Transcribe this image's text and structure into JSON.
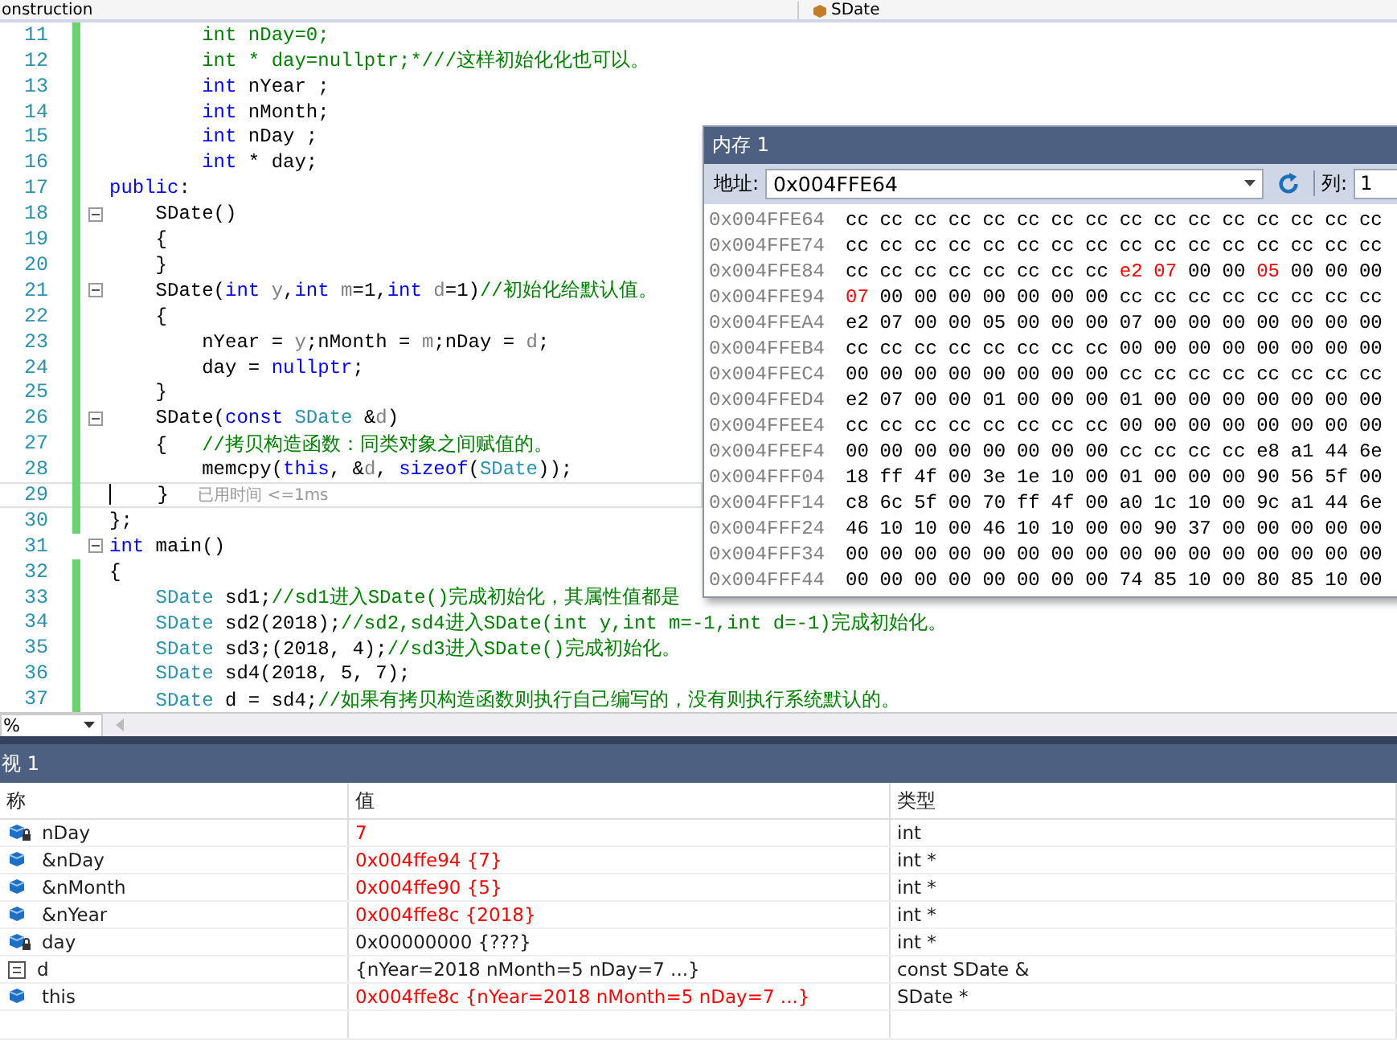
{
  "nav_bar": {
    "project": "onstruction",
    "scope": "SDate"
  },
  "editor": {
    "lines": [
      {
        "number": "11",
        "changed": true,
        "fold": false,
        "current": false,
        "segments": [
          {
            "text": "        int nDay=0;",
            "kind": "comment"
          }
        ]
      },
      {
        "number": "12",
        "changed": true,
        "fold": false,
        "current": false,
        "segments": [
          {
            "text": "        int * day=nullptr;*///这样初始化化也可以。",
            "kind": "comment"
          }
        ]
      },
      {
        "number": "13",
        "changed": true,
        "fold": false,
        "current": false,
        "segments": [
          {
            "text": "        int",
            "kind": "keyword"
          },
          {
            "text": " nYear ;",
            "kind": "plain"
          }
        ]
      },
      {
        "number": "14",
        "changed": true,
        "fold": false,
        "current": false,
        "segments": [
          {
            "text": "        int",
            "kind": "keyword"
          },
          {
            "text": " nMonth;",
            "kind": "plain"
          }
        ]
      },
      {
        "number": "15",
        "changed": true,
        "fold": false,
        "current": false,
        "segments": [
          {
            "text": "        int",
            "kind": "keyword"
          },
          {
            "text": " nDay ;",
            "kind": "plain"
          }
        ]
      },
      {
        "number": "16",
        "changed": true,
        "fold": false,
        "current": false,
        "segments": [
          {
            "text": "        int",
            "kind": "keyword"
          },
          {
            "text": " * day;",
            "kind": "plain"
          }
        ]
      },
      {
        "number": "17",
        "changed": true,
        "fold": false,
        "current": false,
        "segments": [
          {
            "text": "public",
            "kind": "keyword"
          },
          {
            "text": ":",
            "kind": "plain"
          }
        ]
      },
      {
        "number": "18",
        "changed": true,
        "fold": true,
        "current": false,
        "segments": [
          {
            "text": "    SDate()",
            "kind": "plain"
          }
        ]
      },
      {
        "number": "19",
        "changed": true,
        "fold": false,
        "current": false,
        "segments": [
          {
            "text": "    {",
            "kind": "plain"
          }
        ]
      },
      {
        "number": "20",
        "changed": true,
        "fold": false,
        "current": false,
        "segments": [
          {
            "text": "    }",
            "kind": "plain"
          }
        ]
      },
      {
        "number": "21",
        "changed": true,
        "fold": true,
        "current": false,
        "segments": [
          {
            "text": "    SDate(",
            "kind": "plain"
          },
          {
            "text": "int",
            "kind": "keyword"
          },
          {
            "text": " y",
            "kind": "param"
          },
          {
            "text": ",",
            "kind": "plain"
          },
          {
            "text": "int",
            "kind": "keyword"
          },
          {
            "text": " m",
            "kind": "param"
          },
          {
            "text": "=1,",
            "kind": "plain"
          },
          {
            "text": "int",
            "kind": "keyword"
          },
          {
            "text": " d",
            "kind": "param"
          },
          {
            "text": "=1)",
            "kind": "plain"
          },
          {
            "text": "//初始化给默认值。",
            "kind": "comment"
          }
        ]
      },
      {
        "number": "22",
        "changed": true,
        "fold": false,
        "current": false,
        "segments": [
          {
            "text": "    {",
            "kind": "plain"
          }
        ]
      },
      {
        "number": "23",
        "changed": true,
        "fold": false,
        "current": false,
        "segments": [
          {
            "text": "        nYear = ",
            "kind": "plain"
          },
          {
            "text": "y",
            "kind": "param"
          },
          {
            "text": ";nMonth = ",
            "kind": "plain"
          },
          {
            "text": "m",
            "kind": "param"
          },
          {
            "text": ";nDay = ",
            "kind": "plain"
          },
          {
            "text": "d",
            "kind": "param"
          },
          {
            "text": ";",
            "kind": "plain"
          }
        ]
      },
      {
        "number": "24",
        "changed": true,
        "fold": false,
        "current": false,
        "segments": [
          {
            "text": "        day = ",
            "kind": "plain"
          },
          {
            "text": "nullptr",
            "kind": "keyword"
          },
          {
            "text": ";",
            "kind": "plain"
          }
        ]
      },
      {
        "number": "25",
        "changed": true,
        "fold": false,
        "current": false,
        "segments": [
          {
            "text": "    }",
            "kind": "plain"
          }
        ]
      },
      {
        "number": "26",
        "changed": true,
        "fold": true,
        "current": false,
        "segments": [
          {
            "text": "    SDate(",
            "kind": "plain"
          },
          {
            "text": "const",
            "kind": "keyword"
          },
          {
            "text": " SDate",
            "kind": "type"
          },
          {
            "text": " &",
            "kind": "plain"
          },
          {
            "text": "d",
            "kind": "param"
          },
          {
            "text": ")",
            "kind": "plain"
          }
        ]
      },
      {
        "number": "27",
        "changed": true,
        "fold": false,
        "current": false,
        "segments": [
          {
            "text": "    {   ",
            "kind": "plain"
          },
          {
            "text": "//拷贝构造函数：同类对象之间赋值的。",
            "kind": "comment"
          }
        ]
      },
      {
        "number": "28",
        "changed": true,
        "fold": false,
        "current": false,
        "segments": [
          {
            "text": "        memcpy(",
            "kind": "plain"
          },
          {
            "text": "this",
            "kind": "keyword"
          },
          {
            "text": ", &",
            "kind": "plain"
          },
          {
            "text": "d",
            "kind": "param"
          },
          {
            "text": ", ",
            "kind": "plain"
          },
          {
            "text": "sizeof",
            "kind": "keyword"
          },
          {
            "text": "(",
            "kind": "plain"
          },
          {
            "text": "SDate",
            "kind": "type"
          },
          {
            "text": "));",
            "kind": "plain"
          }
        ]
      },
      {
        "number": "29",
        "changed": true,
        "fold": false,
        "current": true,
        "hint": "已用时间 <=1ms",
        "segments": [
          {
            "text": "    }",
            "kind": "plain"
          }
        ]
      },
      {
        "number": "30",
        "changed": true,
        "fold": false,
        "current": false,
        "segments": [
          {
            "text": "};",
            "kind": "plain"
          }
        ]
      },
      {
        "number": "31",
        "changed": false,
        "fold": true,
        "current": false,
        "segments": [
          {
            "text": "int",
            "kind": "keyword"
          },
          {
            "text": " main()",
            "kind": "plain"
          }
        ]
      },
      {
        "number": "32",
        "changed": true,
        "fold": false,
        "current": false,
        "segments": [
          {
            "text": "{",
            "kind": "plain"
          }
        ]
      },
      {
        "number": "33",
        "changed": true,
        "fold": false,
        "current": false,
        "segments": [
          {
            "text": "    SDate",
            "kind": "type"
          },
          {
            "text": " sd1;",
            "kind": "plain"
          },
          {
            "text": "//sd1进入SDate()完成初始化，其属性值都是",
            "kind": "comment"
          }
        ]
      },
      {
        "number": "34",
        "changed": true,
        "fold": false,
        "current": false,
        "segments": [
          {
            "text": "    SDate",
            "kind": "type"
          },
          {
            "text": " sd2(2018);",
            "kind": "plain"
          },
          {
            "text": "//sd2,sd4进入SDate(int y,int m=-1,int d=-1)完成初始化。",
            "kind": "comment"
          }
        ]
      },
      {
        "number": "35",
        "changed": true,
        "fold": false,
        "current": false,
        "segments": [
          {
            "text": "    SDate",
            "kind": "type"
          },
          {
            "text": " sd3;(2018, 4);",
            "kind": "plain"
          },
          {
            "text": "//sd3进入SDate()完成初始化。",
            "kind": "comment"
          }
        ]
      },
      {
        "number": "36",
        "changed": true,
        "fold": false,
        "current": false,
        "segments": [
          {
            "text": "    SDate",
            "kind": "type"
          },
          {
            "text": " sd4(2018, 5, 7);",
            "kind": "plain"
          }
        ]
      },
      {
        "number": "37",
        "changed": true,
        "fold": false,
        "current": false,
        "segments": [
          {
            "text": "    SDate",
            "kind": "type"
          },
          {
            "text": " d = sd4;",
            "kind": "plain"
          },
          {
            "text": "//如果有拷贝构造函数则执行自己编写的，没有则执行系统默认的。",
            "kind": "comment"
          }
        ]
      }
    ]
  },
  "memory": {
    "title": "内存 1",
    "address_label": "地址:",
    "address": "0x004FFE64",
    "columns_label": "列:",
    "columns": "1",
    "rows": [
      {
        "address": "0x004FFE64",
        "bytes": [
          "cc",
          "cc",
          "cc",
          "cc",
          "cc",
          "cc",
          "cc",
          "cc",
          "cc",
          "cc",
          "cc",
          "cc",
          "cc",
          "cc",
          "cc",
          "cc"
        ],
        "changed": [
          false,
          false,
          false,
          false,
          false,
          false,
          false,
          false,
          false,
          false,
          false,
          false,
          false,
          false,
          false,
          false
        ]
      },
      {
        "address": "0x004FFE74",
        "bytes": [
          "cc",
          "cc",
          "cc",
          "cc",
          "cc",
          "cc",
          "cc",
          "cc",
          "cc",
          "cc",
          "cc",
          "cc",
          "cc",
          "cc",
          "cc",
          "cc"
        ],
        "changed": [
          false,
          false,
          false,
          false,
          false,
          false,
          false,
          false,
          false,
          false,
          false,
          false,
          false,
          false,
          false,
          false
        ]
      },
      {
        "address": "0x004FFE84",
        "bytes": [
          "cc",
          "cc",
          "cc",
          "cc",
          "cc",
          "cc",
          "cc",
          "cc",
          "e2",
          "07",
          "00",
          "00",
          "05",
          "00",
          "00",
          "00"
        ],
        "changed": [
          false,
          false,
          false,
          false,
          false,
          false,
          false,
          false,
          true,
          true,
          false,
          false,
          true,
          false,
          false,
          false
        ]
      },
      {
        "address": "0x004FFE94",
        "bytes": [
          "07",
          "00",
          "00",
          "00",
          "00",
          "00",
          "00",
          "00",
          "cc",
          "cc",
          "cc",
          "cc",
          "cc",
          "cc",
          "cc",
          "cc"
        ],
        "changed": [
          true,
          false,
          false,
          false,
          false,
          false,
          false,
          false,
          false,
          false,
          false,
          false,
          false,
          false,
          false,
          false
        ]
      },
      {
        "address": "0x004FFEA4",
        "bytes": [
          "e2",
          "07",
          "00",
          "00",
          "05",
          "00",
          "00",
          "00",
          "07",
          "00",
          "00",
          "00",
          "00",
          "00",
          "00",
          "00"
        ],
        "changed": [
          false,
          false,
          false,
          false,
          false,
          false,
          false,
          false,
          false,
          false,
          false,
          false,
          false,
          false,
          false,
          false
        ]
      },
      {
        "address": "0x004FFEB4",
        "bytes": [
          "cc",
          "cc",
          "cc",
          "cc",
          "cc",
          "cc",
          "cc",
          "cc",
          "00",
          "00",
          "00",
          "00",
          "00",
          "00",
          "00",
          "00"
        ],
        "changed": [
          false,
          false,
          false,
          false,
          false,
          false,
          false,
          false,
          false,
          false,
          false,
          false,
          false,
          false,
          false,
          false
        ]
      },
      {
        "address": "0x004FFEC4",
        "bytes": [
          "00",
          "00",
          "00",
          "00",
          "00",
          "00",
          "00",
          "00",
          "cc",
          "cc",
          "cc",
          "cc",
          "cc",
          "cc",
          "cc",
          "cc"
        ],
        "changed": [
          false,
          false,
          false,
          false,
          false,
          false,
          false,
          false,
          false,
          false,
          false,
          false,
          false,
          false,
          false,
          false
        ]
      },
      {
        "address": "0x004FFED4",
        "bytes": [
          "e2",
          "07",
          "00",
          "00",
          "01",
          "00",
          "00",
          "00",
          "01",
          "00",
          "00",
          "00",
          "00",
          "00",
          "00",
          "00"
        ],
        "changed": [
          false,
          false,
          false,
          false,
          false,
          false,
          false,
          false,
          false,
          false,
          false,
          false,
          false,
          false,
          false,
          false
        ]
      },
      {
        "address": "0x004FFEE4",
        "bytes": [
          "cc",
          "cc",
          "cc",
          "cc",
          "cc",
          "cc",
          "cc",
          "cc",
          "00",
          "00",
          "00",
          "00",
          "00",
          "00",
          "00",
          "00"
        ],
        "changed": [
          false,
          false,
          false,
          false,
          false,
          false,
          false,
          false,
          false,
          false,
          false,
          false,
          false,
          false,
          false,
          false
        ]
      },
      {
        "address": "0x004FFEF4",
        "bytes": [
          "00",
          "00",
          "00",
          "00",
          "00",
          "00",
          "00",
          "00",
          "cc",
          "cc",
          "cc",
          "cc",
          "e8",
          "a1",
          "44",
          "6e"
        ],
        "changed": [
          false,
          false,
          false,
          false,
          false,
          false,
          false,
          false,
          false,
          false,
          false,
          false,
          false,
          false,
          false,
          false
        ]
      },
      {
        "address": "0x004FFF04",
        "bytes": [
          "18",
          "ff",
          "4f",
          "00",
          "3e",
          "1e",
          "10",
          "00",
          "01",
          "00",
          "00",
          "00",
          "90",
          "56",
          "5f",
          "00"
        ],
        "changed": [
          false,
          false,
          false,
          false,
          false,
          false,
          false,
          false,
          false,
          false,
          false,
          false,
          false,
          false,
          false,
          false
        ]
      },
      {
        "address": "0x004FFF14",
        "bytes": [
          "c8",
          "6c",
          "5f",
          "00",
          "70",
          "ff",
          "4f",
          "00",
          "a0",
          "1c",
          "10",
          "00",
          "9c",
          "a1",
          "44",
          "6e"
        ],
        "changed": [
          false,
          false,
          false,
          false,
          false,
          false,
          false,
          false,
          false,
          false,
          false,
          false,
          false,
          false,
          false,
          false
        ]
      },
      {
        "address": "0x004FFF24",
        "bytes": [
          "46",
          "10",
          "10",
          "00",
          "46",
          "10",
          "10",
          "00",
          "00",
          "90",
          "37",
          "00",
          "00",
          "00",
          "00",
          "00"
        ],
        "changed": [
          false,
          false,
          false,
          false,
          false,
          false,
          false,
          false,
          false,
          false,
          false,
          false,
          false,
          false,
          false,
          false
        ]
      },
      {
        "address": "0x004FFF34",
        "bytes": [
          "00",
          "00",
          "00",
          "00",
          "00",
          "00",
          "00",
          "00",
          "00",
          "00",
          "00",
          "00",
          "00",
          "00",
          "00",
          "00"
        ],
        "changed": [
          false,
          false,
          false,
          false,
          false,
          false,
          false,
          false,
          false,
          false,
          false,
          false,
          false,
          false,
          false,
          false
        ]
      },
      {
        "address": "0x004FFF44",
        "bytes": [
          "00",
          "00",
          "00",
          "00",
          "00",
          "00",
          "00",
          "00",
          "74",
          "85",
          "10",
          "00",
          "80",
          "85",
          "10",
          "00"
        ],
        "changed": [
          false,
          false,
          false,
          false,
          false,
          false,
          false,
          false,
          false,
          false,
          false,
          false,
          false,
          false,
          false,
          false
        ]
      }
    ]
  },
  "zoom": "%",
  "watch": {
    "title": "视 1",
    "columns": [
      "称",
      "值",
      "类型"
    ],
    "rows": [
      {
        "kind": "private-field",
        "name": "nDay",
        "value": "7",
        "type": "int",
        "changed": true
      },
      {
        "kind": "field",
        "name": "&nDay",
        "value": "0x004ffe94 {7}",
        "type": "int *",
        "changed": true
      },
      {
        "kind": "field",
        "name": "&nMonth",
        "value": "0x004ffe90 {5}",
        "type": "int *",
        "changed": true
      },
      {
        "kind": "field",
        "name": "&nYear",
        "value": "0x004ffe8c {2018}",
        "type": "int *",
        "changed": true
      },
      {
        "kind": "private-field",
        "name": "day",
        "value": "0x00000000 {???}",
        "type": "int *",
        "changed": false
      },
      {
        "kind": "object",
        "name": "d",
        "value": "{nYear=2018 nMonth=5 nDay=7 ...}",
        "type": "const SDate &",
        "changed": false
      },
      {
        "kind": "field",
        "name": "this",
        "value": "0x004ffe8c {nYear=2018 nMonth=5 nDay=7 ...}",
        "type": "SDate *",
        "changed": true
      }
    ]
  }
}
